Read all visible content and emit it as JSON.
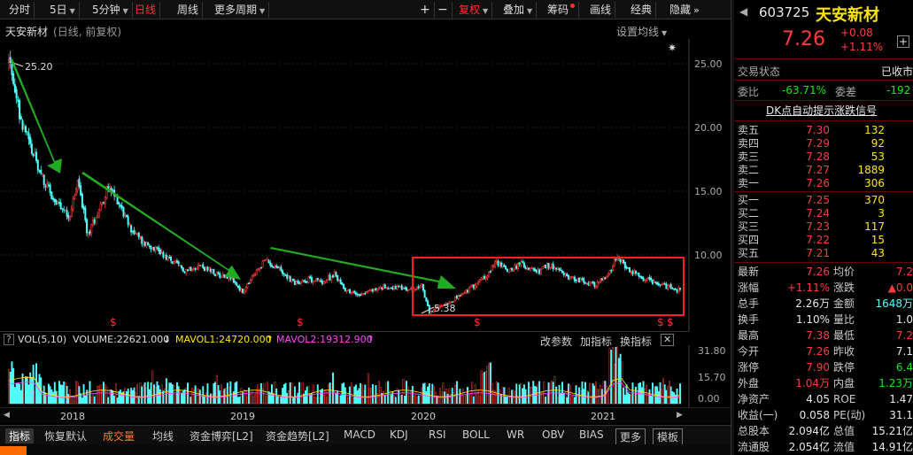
{
  "toolbar": {
    "items": [
      {
        "label": "分时",
        "dd": ""
      },
      {
        "label": "5日",
        "dd": "▼"
      },
      {
        "label": "5分钟",
        "dd": "▼"
      },
      {
        "label": "日线",
        "dd": ""
      },
      {
        "label": "周线",
        "dd": ""
      },
      {
        "label": "更多周期",
        "dd": "▼"
      }
    ],
    "right_items": [
      {
        "label": "+"
      },
      {
        "label": "−"
      },
      {
        "label": "复权",
        "dd": "▼"
      },
      {
        "label": "叠加",
        "dd": "▼"
      },
      {
        "label": "筹码"
      },
      {
        "label": "画线"
      },
      {
        "label": "经典"
      },
      {
        "label": "隐藏",
        "dd": "»"
      }
    ]
  },
  "chart": {
    "stock_name": "天安新材",
    "subtitle": "(日线, 前复权)",
    "ma_setting": "设置均线",
    "ma_dd": "▼",
    "max_label": "25.20",
    "min_label": "5.38",
    "y_ticks": [
      "25.00",
      "20.00",
      "15.00",
      "10.00"
    ],
    "dollar_marks": [
      "$",
      "$",
      "$",
      "$",
      "$"
    ]
  },
  "chart_data": {
    "type": "candlestick",
    "title": "天安新材",
    "x_labels": [
      "2018",
      "2019",
      "2020",
      "2021"
    ],
    "y_ticks": [
      25.0,
      20.0,
      15.0,
      10.0
    ],
    "ylim": [
      5.0,
      27.0
    ],
    "max_point": 25.2,
    "min_point": 5.38,
    "price_path": [
      [
        2017.72,
        25.2
      ],
      [
        2017.78,
        21.0
      ],
      [
        2017.85,
        18.0
      ],
      [
        2017.92,
        15.5
      ],
      [
        2017.98,
        14.0
      ],
      [
        2018.05,
        13.0
      ],
      [
        2018.1,
        15.8
      ],
      [
        2018.15,
        11.5
      ],
      [
        2018.2,
        13.2
      ],
      [
        2018.26,
        15.2
      ],
      [
        2018.32,
        14.2
      ],
      [
        2018.38,
        12.2
      ],
      [
        2018.45,
        11.0
      ],
      [
        2018.52,
        10.6
      ],
      [
        2018.6,
        9.6
      ],
      [
        2018.68,
        8.8
      ],
      [
        2018.76,
        9.2
      ],
      [
        2018.85,
        8.5
      ],
      [
        2018.93,
        8.3
      ],
      [
        2019.0,
        7.0
      ],
      [
        2019.05,
        8.2
      ],
      [
        2019.12,
        9.6
      ],
      [
        2019.2,
        8.9
      ],
      [
        2019.28,
        7.8
      ],
      [
        2019.36,
        8.1
      ],
      [
        2019.44,
        7.9
      ],
      [
        2019.5,
        8.5
      ],
      [
        2019.56,
        7.3
      ],
      [
        2019.62,
        6.9
      ],
      [
        2019.7,
        7.2
      ],
      [
        2019.78,
        7.5
      ],
      [
        2019.85,
        7.4
      ],
      [
        2019.92,
        7.2
      ],
      [
        2019.98,
        7.6
      ],
      [
        2020.02,
        5.38
      ],
      [
        2020.08,
        6.0
      ],
      [
        2020.15,
        6.5
      ],
      [
        2020.2,
        6.9
      ],
      [
        2020.28,
        7.8
      ],
      [
        2020.34,
        8.5
      ],
      [
        2020.38,
        9.5
      ],
      [
        2020.45,
        8.8
      ],
      [
        2020.52,
        9.3
      ],
      [
        2020.6,
        8.6
      ],
      [
        2020.68,
        9.2
      ],
      [
        2020.76,
        8.4
      ],
      [
        2020.84,
        8.0
      ],
      [
        2020.92,
        7.6
      ],
      [
        2021.0,
        8.4
      ],
      [
        2021.04,
        9.8
      ],
      [
        2021.1,
        9.0
      ],
      [
        2021.18,
        8.2
      ],
      [
        2021.26,
        7.8
      ],
      [
        2021.32,
        7.5
      ],
      [
        2021.38,
        7.26
      ]
    ],
    "volume": {
      "label": "VOL(5,10)",
      "volume": 22621.0,
      "mavol1": 24720.0,
      "mavol2": 19312.9,
      "y_ticks": [
        31.8,
        15.7,
        0.0
      ]
    }
  },
  "vol_header": {
    "lock_icon": "?",
    "label": "VOL(5,10)",
    "volume": "VOLUME:22621.000",
    "mavol1": "MAVOL1:24720.000",
    "mavol2": "MAVOL2:19312.900",
    "arrow_down": "↓",
    "arrow_up1": "↑",
    "arrow_up2": "↑",
    "btn_params": "改参数",
    "btn_add": "加指标",
    "btn_switch": "换指标",
    "btn_close": "✕",
    "y_ticks": [
      "31.80",
      "15.70",
      "0.00"
    ]
  },
  "xaxis": {
    "labels": [
      "2018",
      "2019",
      "2020",
      "2021"
    ]
  },
  "bottom_tabs": [
    "指标",
    "恢复默认",
    "成交量",
    "均线",
    "资金博弈[L2]",
    "资金趋势[L2]",
    "MACD",
    "KDJ",
    "RSI",
    "BOLL",
    "WR",
    "OBV",
    "BIAS",
    "更多",
    "模板"
  ],
  "panel": {
    "code": "603725",
    "name": "天安新材",
    "price": "7.26",
    "change": "+0.08",
    "change_pct": "+1.11%",
    "trade_status_label": "交易状态",
    "trade_status": "已收市",
    "weibi_label": "委比",
    "weibi": "-63.71%",
    "weicha_label": "委差",
    "weicha": "-192",
    "signal": "DK点自动提示涨跌信号",
    "sell": [
      {
        "label": "卖五",
        "price": "7.30",
        "vol": "132"
      },
      {
        "label": "卖四",
        "price": "7.29",
        "vol": "92"
      },
      {
        "label": "卖三",
        "price": "7.28",
        "vol": "53"
      },
      {
        "label": "卖二",
        "price": "7.27",
        "vol": "1889"
      },
      {
        "label": "卖一",
        "price": "7.26",
        "vol": "306"
      }
    ],
    "buy": [
      {
        "label": "买一",
        "price": "7.25",
        "vol": "370"
      },
      {
        "label": "买二",
        "price": "7.24",
        "vol": "3"
      },
      {
        "label": "买三",
        "price": "7.23",
        "vol": "117"
      },
      {
        "label": "买四",
        "price": "7.22",
        "vol": "15"
      },
      {
        "label": "买五",
        "price": "7.21",
        "vol": "43"
      }
    ],
    "stats": [
      [
        "最新",
        "7.26",
        "均价",
        "7.2"
      ],
      [
        "涨幅",
        "+1.11%",
        "涨跌",
        "▲0.0"
      ],
      [
        "总手",
        "2.26万",
        "金额",
        "1648万"
      ],
      [
        "换手",
        "1.10%",
        "量比",
        "1.0"
      ],
      [
        "最高",
        "7.38",
        "最低",
        "7.2"
      ],
      [
        "今开",
        "7.26",
        "昨收",
        "7.1"
      ],
      [
        "涨停",
        "7.90",
        "跌停",
        "6.4"
      ],
      [
        "外盘",
        "1.04万",
        "内盘",
        "1.23万"
      ],
      [
        "净资产",
        "4.05",
        "ROE",
        "1.47"
      ],
      [
        "收益(一)",
        "0.058",
        "PE(动)",
        "31.1"
      ],
      [
        "总股本",
        "2.094亿",
        "总值",
        "15.21亿"
      ],
      [
        "流通股",
        "2.054亿",
        "流值",
        "14.91亿"
      ]
    ]
  },
  "colors": {
    "up": "#ff3b3b",
    "down": "#19e619",
    "accent": "#ff3030",
    "candle_down": "#54ffff",
    "box": "#ff2020",
    "arrow": "#22aa22"
  }
}
